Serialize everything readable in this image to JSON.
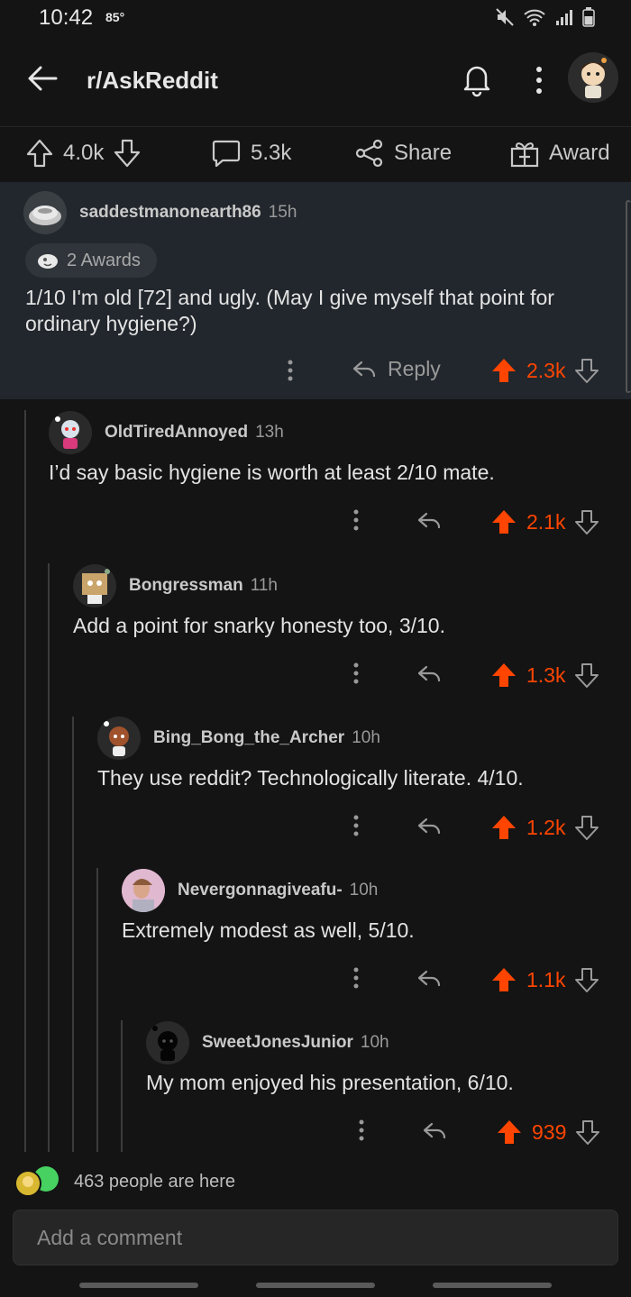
{
  "status": {
    "time": "10:42",
    "temperature": "85°"
  },
  "header": {
    "title": "r/AskReddit"
  },
  "post_actions": {
    "upvotes": "4.0k",
    "comments": "5.3k",
    "share": "Share",
    "award": "Award"
  },
  "top_comment": {
    "username": "saddestmanonearth86",
    "age": "15h",
    "awards": "2 Awards",
    "text": "1/10  I'm old [72] and ugly.  (May I give myself that point for ordinary hygiene?)",
    "reply": "Reply",
    "score": "2.3k"
  },
  "replies": [
    {
      "username": "OldTiredAnnoyed",
      "age": "13h",
      "text": "I’d say basic hygiene is worth at least 2/10 mate.",
      "score": "2.1k"
    },
    {
      "username": "Bongressman",
      "age": "11h",
      "text": "Add a point for snarky honesty too, 3/10.",
      "score": "1.3k"
    },
    {
      "username": "Bing_Bong_the_Archer",
      "age": "10h",
      "text": "They use reddit? Technologically literate. 4/10.",
      "score": "1.2k"
    },
    {
      "username": "Nevergonnagiveafu-",
      "age": "10h",
      "text": "Extremely modest as well, 5/10.",
      "score": "1.1k"
    },
    {
      "username": "SweetJonesJunior",
      "age": "10h",
      "text": "My mom enjoyed his presentation, 6/10.",
      "score": "939"
    }
  ],
  "presence": {
    "text": "463 people are here"
  },
  "comment_input": {
    "placeholder": "Add a comment"
  },
  "colors": {
    "accent": "#ff4500",
    "background": "#141414",
    "highlight": "#22272d"
  }
}
